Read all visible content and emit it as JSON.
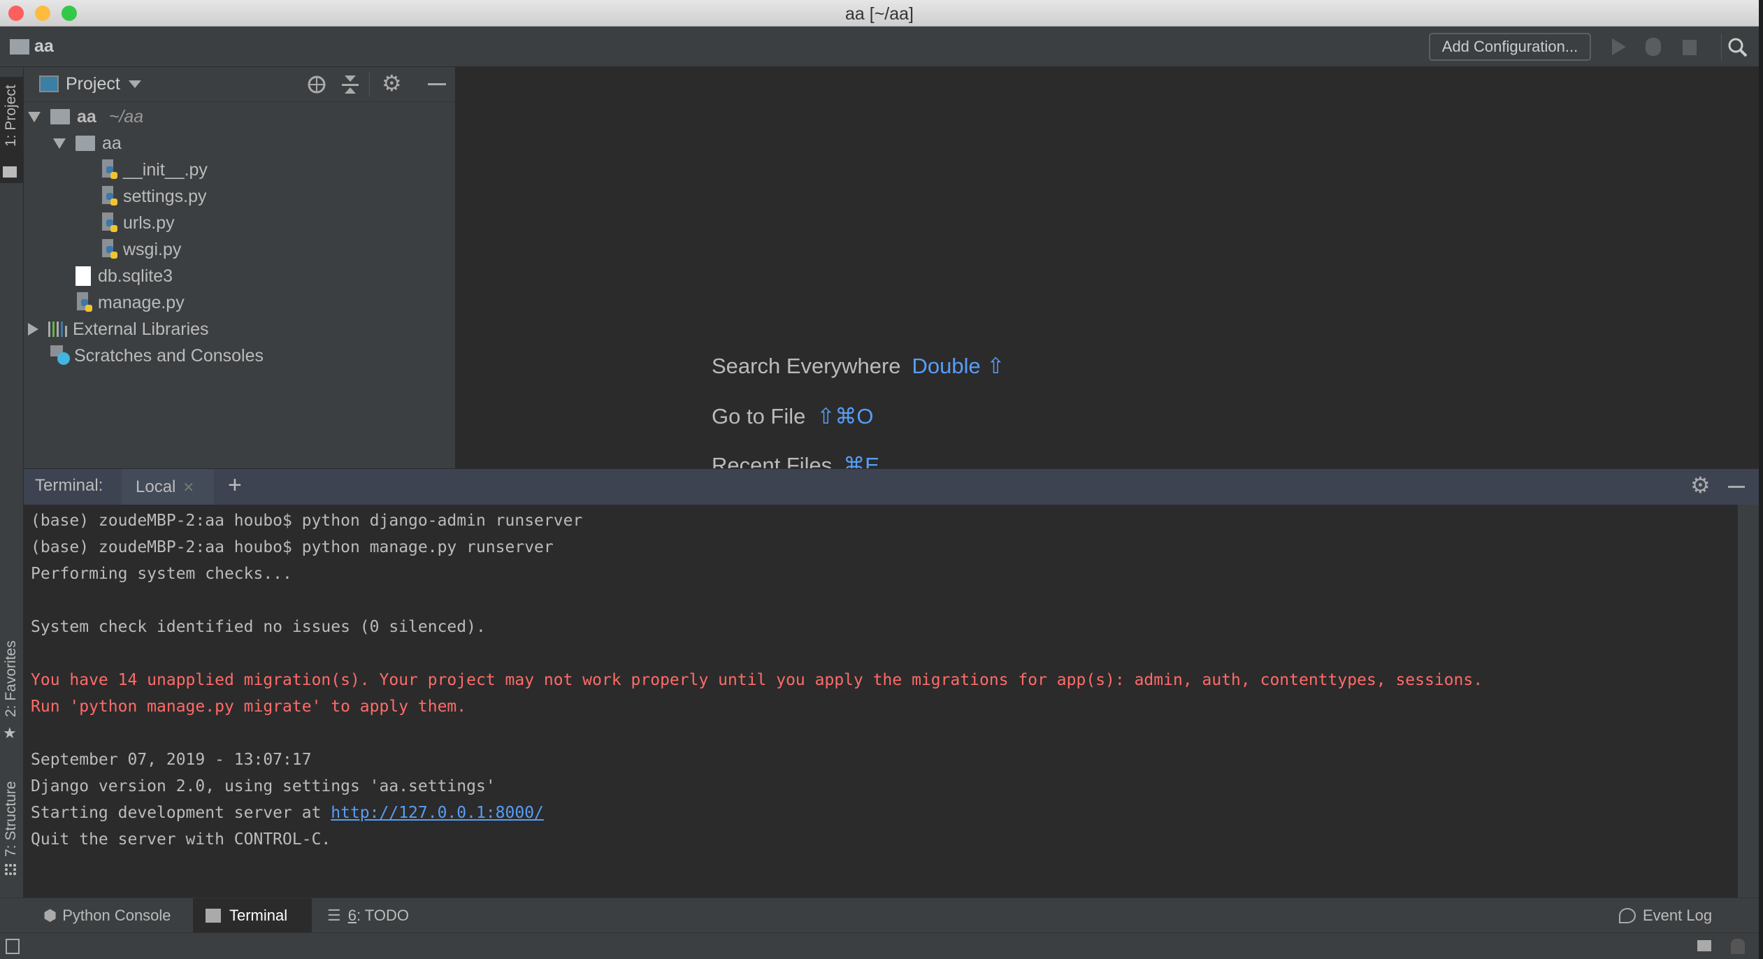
{
  "window": {
    "title": "aa [~/aa]"
  },
  "toolbar": {
    "project_name": "aa",
    "add_config": "Add Configuration...",
    "icons": [
      "run-icon",
      "debug-icon",
      "stop-icon",
      "search-icon"
    ]
  },
  "left_stripe": {
    "project": "1: Project",
    "favorites": "2: Favorites",
    "structure": "7: Structure"
  },
  "project_panel": {
    "title": "Project",
    "tree": [
      {
        "label": "aa",
        "suffix": "~/aa",
        "type": "root-folder",
        "expanded": true
      },
      {
        "label": "aa",
        "type": "package",
        "expanded": true
      },
      {
        "label": "__init__.py",
        "type": "python"
      },
      {
        "label": "settings.py",
        "type": "python"
      },
      {
        "label": "urls.py",
        "type": "python"
      },
      {
        "label": "wsgi.py",
        "type": "python"
      },
      {
        "label": "db.sqlite3",
        "type": "file"
      },
      {
        "label": "manage.py",
        "type": "python"
      },
      {
        "label": "External Libraries",
        "type": "libraries",
        "expanded": false
      },
      {
        "label": "Scratches and Consoles",
        "type": "scratches"
      }
    ]
  },
  "editor": {
    "hints": [
      {
        "label": "Search Everywhere",
        "key": "Double ⇧"
      },
      {
        "label": "Go to File",
        "key": "⇧⌘O"
      },
      {
        "label": "Recent Files",
        "key": "⌘E"
      }
    ]
  },
  "terminal": {
    "label": "Terminal:",
    "tab": "Local",
    "add": "+",
    "lines": [
      {
        "text": "(base) zoudeMBP-2:aa houbo$ python django-admin runserver"
      },
      {
        "text": "(base) zoudeMBP-2:aa houbo$ python manage.py runserver"
      },
      {
        "text": "Performing system checks..."
      },
      {
        "text": ""
      },
      {
        "text": "System check identified no issues (0 silenced)."
      },
      {
        "text": ""
      },
      {
        "text": "You have 14 unapplied migration(s). Your project may not work properly until you apply the migrations for app(s): admin, auth, contenttypes, sessions.",
        "error": true
      },
      {
        "text": "Run 'python manage.py migrate' to apply them.",
        "error": true
      },
      {
        "text": ""
      },
      {
        "text": "September 07, 2019 - 13:07:17"
      },
      {
        "text": "Django version 2.0, using settings 'aa.settings'"
      },
      {
        "text": "Starting development server at ",
        "link": "http://127.0.0.1:8000/"
      },
      {
        "text": "Quit the server with CONTROL-C."
      }
    ]
  },
  "bottom_tabs": {
    "python_console": "Python Console",
    "terminal": "Terminal",
    "todo_num": "6",
    "todo": ": TODO",
    "event_log": "Event Log"
  },
  "colors": {
    "accent": "#589df6",
    "error": "#ff6b68",
    "background": "#2b2b2b",
    "panel": "#3c3f41"
  }
}
